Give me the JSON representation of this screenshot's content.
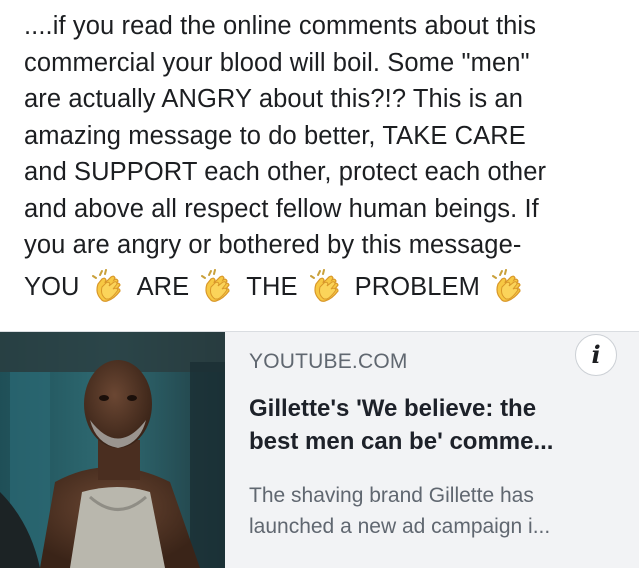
{
  "post": {
    "lines": [
      "....if you read the online comments about this",
      "commercial your blood will boil. Some \"men\"",
      "are actually ANGRY about this?!? This is an",
      "amazing message to do better, TAKE CARE",
      "and SUPPORT each other, protect each other",
      "and above all respect fellow human beings. If",
      "you are angry or bothered by this message-"
    ],
    "final_words": [
      "YOU",
      "ARE",
      "THE",
      "PROBLEM"
    ],
    "emoji_icon": "clapping-hands-icon"
  },
  "link_preview": {
    "domain": "YOUTUBE.COM",
    "title_lines": [
      "Gillette's 'We believe: the",
      "best men can be' comme..."
    ],
    "description_lines": [
      "The shaving brand Gillette has",
      "launched a new ad campaign i..."
    ],
    "info_icon_glyph": "i",
    "background": "#f2f3f5"
  }
}
